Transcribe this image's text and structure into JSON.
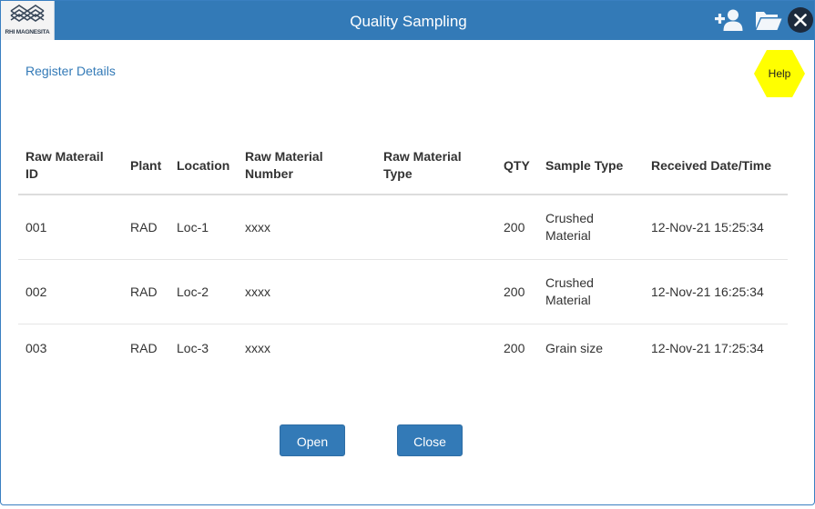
{
  "app": {
    "title": "Quality Sampling",
    "logo_text": "RHI MAGNESITA"
  },
  "toolbar": {
    "icons": [
      "add-user-icon",
      "folder-open-icon",
      "close-icon"
    ]
  },
  "page": {
    "register_link": "Register Details",
    "help_label": "Help"
  },
  "table": {
    "headers": [
      "Raw Materail ID",
      "Plant",
      "Location",
      "Raw Material Number",
      "Raw Material Type",
      "QTY",
      "Sample Type",
      "Received Date/Time"
    ],
    "rows": [
      {
        "id": "001",
        "plant": "RAD",
        "location": "Loc-1",
        "number": "xxxx",
        "type": "",
        "qty": "200",
        "sample_type": "Crushed Material",
        "received": "12-Nov-21 15:25:34"
      },
      {
        "id": "002",
        "plant": "RAD",
        "location": "Loc-2",
        "number": "xxxx",
        "type": "",
        "qty": "200",
        "sample_type": "Crushed Material",
        "received": "12-Nov-21 16:25:34"
      },
      {
        "id": "003",
        "plant": "RAD",
        "location": "Loc-3",
        "number": "xxxx",
        "type": "",
        "qty": "200",
        "sample_type": "Grain size",
        "received": "12-Nov-21 17:25:34"
      }
    ]
  },
  "buttons": {
    "open_label": "Open",
    "close_label": "Close"
  },
  "colors": {
    "primary": "#337ab7",
    "help_badge": "#ffff00",
    "close_circle": "#1c2a3d"
  }
}
